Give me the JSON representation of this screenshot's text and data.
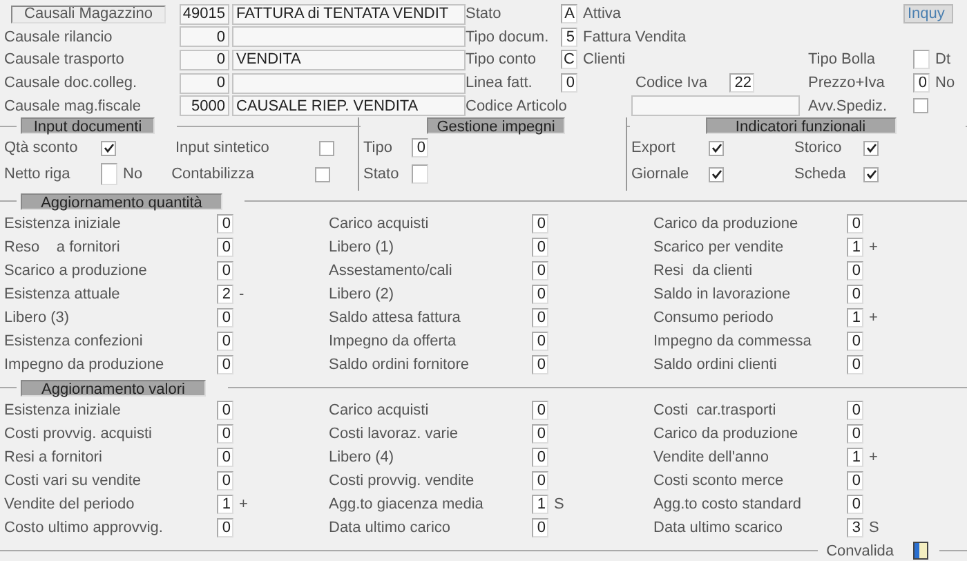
{
  "header": {
    "button": "Causali Magazzino",
    "code": "49015",
    "description": "FATTURA di TENTATA VENDIT"
  },
  "causali": [
    {
      "label": "Causale rilancio",
      "code": "0"
    },
    {
      "label": "Causale trasporto",
      "code": "0",
      "description": "VENDITA"
    },
    {
      "label": "Causale doc.colleg.",
      "code": "0"
    },
    {
      "label": "Causale mag.fiscale",
      "code": "5000",
      "description": "CAUSALE RIEP. VENDITA"
    }
  ],
  "status_fields": [
    {
      "label": "Stato",
      "value": "A",
      "text": "Attiva"
    },
    {
      "label": "Tipo docum.",
      "value": "5",
      "text": "Fattura Vendita"
    },
    {
      "label": "Tipo conto",
      "value": "C",
      "text": "Clienti"
    }
  ],
  "linea_fatt": {
    "label": "Linea fatt.",
    "value": "0"
  },
  "codice_iva": {
    "label": "Codice Iva",
    "value": "22"
  },
  "codice_articolo": {
    "label": "Codice Articolo"
  },
  "inquiry_button": "Inquy",
  "tipo_bolla": {
    "label": "Tipo Bolla",
    "text": "Dt"
  },
  "prezzo_iva": {
    "label": "Prezzo+Iva",
    "value": "0",
    "text": "No"
  },
  "avv_spediz": {
    "label": "Avv.Spediz.",
    "checked": false
  },
  "input_documenti": {
    "title": "Input documenti",
    "rows": [
      [
        {
          "kind": "check",
          "label": "Qtà sconto",
          "checked": true
        },
        {
          "kind": "check",
          "label": "Input sintetico",
          "checked": false
        }
      ],
      [
        {
          "kind": "field",
          "label": "Netto riga",
          "text": "No"
        },
        {
          "kind": "check",
          "label": "Contabilizza",
          "checked": false
        }
      ]
    ]
  },
  "gestione_impegni": {
    "title": "Gestione impegni",
    "rows": [
      {
        "label": "Tipo",
        "value": "0"
      },
      {
        "label": "Stato"
      }
    ]
  },
  "indicatori": {
    "title": "Indicatori funzionali",
    "rows": [
      [
        {
          "label": "Export",
          "checked": true
        },
        {
          "label": "Storico",
          "checked": true
        }
      ],
      [
        {
          "label": "Giornale",
          "checked": true
        },
        {
          "label": "Scheda",
          "checked": true
        }
      ]
    ]
  },
  "aggiornamento_quantita": {
    "title": "Aggiornamento quantità",
    "rows": [
      [
        {
          "label": "Esistenza iniziale",
          "value": "0"
        },
        {
          "label": "Carico acquisti",
          "value": "0"
        },
        {
          "label": "Carico da produzione",
          "value": "0"
        }
      ],
      [
        {
          "label": "Reso    a fornitori",
          "value": "0"
        },
        {
          "label": "Libero (1)",
          "value": "0"
        },
        {
          "label": "Scarico per vendite",
          "value": "1",
          "suffix": "+"
        }
      ],
      [
        {
          "label": "Scarico a produzione",
          "value": "0"
        },
        {
          "label": "Assestamento/cali",
          "value": "0"
        },
        {
          "label": "Resi  da clienti",
          "value": "0"
        }
      ],
      [
        {
          "label": "Esistenza attuale",
          "value": "2",
          "suffix": "-"
        },
        {
          "label": "Libero (2)",
          "value": "0"
        },
        {
          "label": "Saldo in lavorazione",
          "value": "0"
        }
      ],
      [
        {
          "label": "Libero (3)",
          "value": "0"
        },
        {
          "label": "Saldo attesa fattura",
          "value": "0"
        },
        {
          "label": "Consumo periodo",
          "value": "1",
          "suffix": "+"
        }
      ],
      [
        {
          "label": "Esistenza confezioni",
          "value": "0"
        },
        {
          "label": "Impegno da offerta",
          "value": "0"
        },
        {
          "label": "Impegno da commessa",
          "value": "0"
        }
      ],
      [
        {
          "label": "Impegno da produzione",
          "value": "0"
        },
        {
          "label": "Saldo ordini fornitore",
          "value": "0"
        },
        {
          "label": "Saldo ordini clienti",
          "value": "0"
        }
      ]
    ]
  },
  "aggiornamento_valori": {
    "title": "Aggiornamento valori",
    "rows": [
      [
        {
          "label": "Esistenza iniziale",
          "value": "0"
        },
        {
          "label": "Carico acquisti",
          "value": "0"
        },
        {
          "label": "Costi  car.trasporti",
          "value": "0"
        }
      ],
      [
        {
          "label": "Costi provvig. acquisti",
          "value": "0"
        },
        {
          "label": "Costi lavoraz. varie",
          "value": "0"
        },
        {
          "label": "Carico da produzione",
          "value": "0"
        }
      ],
      [
        {
          "label": "Resi a fornitori",
          "value": "0"
        },
        {
          "label": "Libero (4)",
          "value": "0"
        },
        {
          "label": "Vendite dell'anno",
          "value": "1",
          "suffix": "+"
        }
      ],
      [
        {
          "label": "Costi vari su vendite",
          "value": "0"
        },
        {
          "label": "Costi provvig. vendite",
          "value": "0"
        },
        {
          "label": "Costi sconto merce",
          "value": "0"
        }
      ],
      [
        {
          "label": "Vendite del periodo",
          "value": "1",
          "suffix": "+"
        },
        {
          "label": "Agg.to giacenza media",
          "value": "1",
          "suffix": "S"
        },
        {
          "label": "Agg.to costo standard",
          "value": "0"
        }
      ],
      [
        {
          "label": "Costo ultimo approvvig.",
          "value": "0"
        },
        {
          "label": "Data ultimo carico",
          "value": "0"
        },
        {
          "label": "Data ultimo scarico",
          "value": "3",
          "suffix": "S"
        }
      ]
    ]
  },
  "footer": {
    "label": "Convalida"
  }
}
